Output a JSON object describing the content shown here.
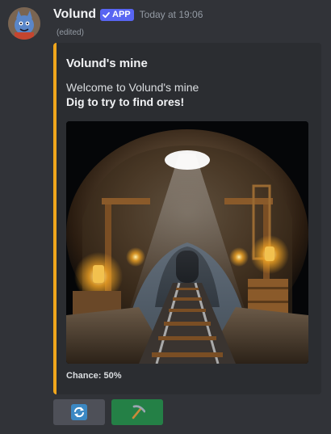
{
  "colors": {
    "background": "#313338",
    "embed_background": "#2b2d31",
    "embed_accent": "#f0a61c",
    "badge": "#5865f2",
    "secondary_button": "#4e5058",
    "success_button": "#248046"
  },
  "message": {
    "avatar_icon": "blue-creature-avatar-icon",
    "username": "Volund",
    "badge": {
      "icon": "checkmark-icon",
      "label": "APP"
    },
    "timestamp": "Today at 19:06",
    "edited": "(edited)"
  },
  "embed": {
    "title": "Volund's mine",
    "description_line1": "Welcome to Volund's mine",
    "description_line2": "Dig to try to find ores!",
    "image_icon": "pixel-art-mine-tunnel-image",
    "footer": "Chance: 50%"
  },
  "buttons": [
    {
      "icon": "refresh-icon",
      "style": "secondary"
    },
    {
      "icon": "pickaxe-icon",
      "style": "success"
    }
  ]
}
